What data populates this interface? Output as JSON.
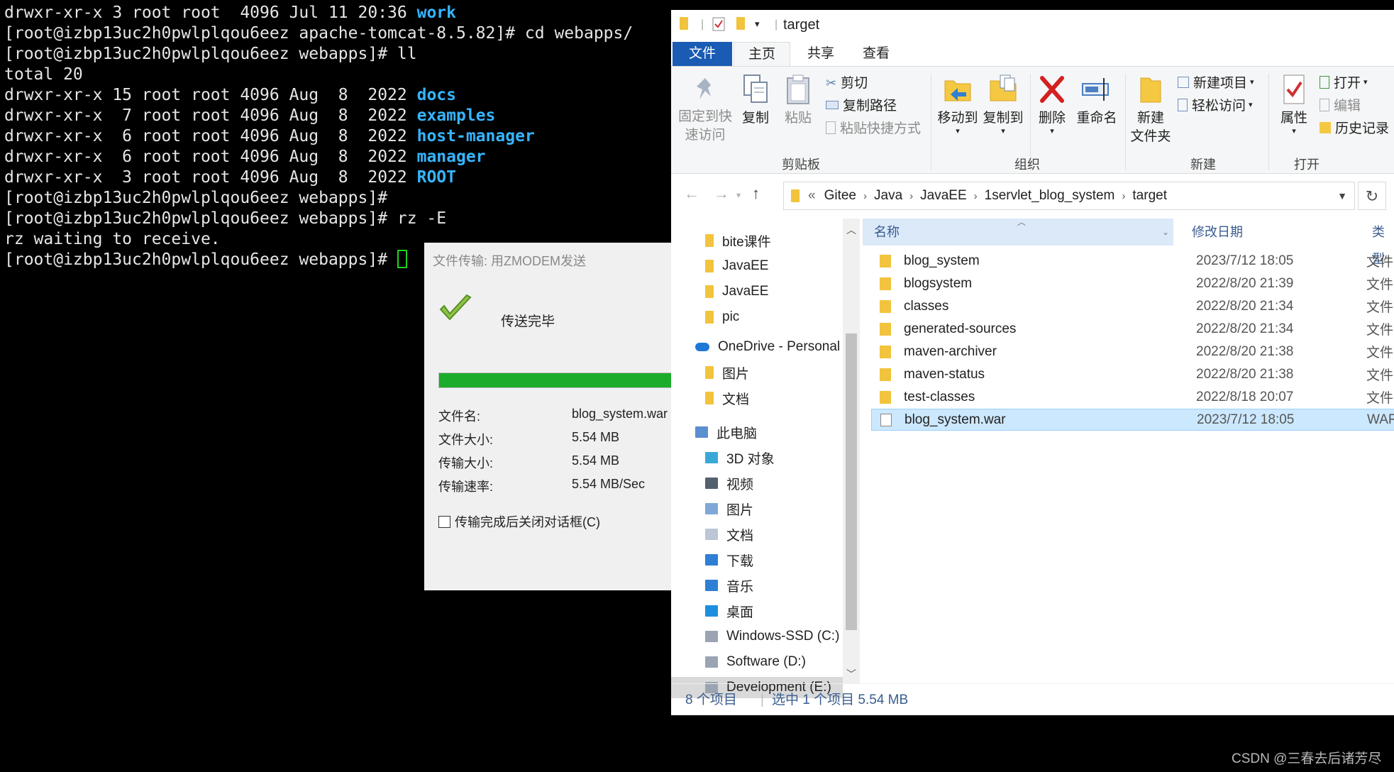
{
  "terminal": {
    "lines": [
      {
        "prefix": "drwxr-xr-x 3 root root  4096 Jul 11 20:36 ",
        "dir": "work"
      },
      {
        "prefix": "[root@izbp13uc2h0pwlplqou6eez apache-tomcat-8.5.82]# cd webapps/",
        "dir": ""
      },
      {
        "prefix": "[root@izbp13uc2h0pwlplqou6eez webapps]# ll",
        "dir": ""
      },
      {
        "prefix": "total 20",
        "dir": ""
      },
      {
        "prefix": "drwxr-xr-x 15 root root 4096 Aug  8  2022 ",
        "dir": "docs"
      },
      {
        "prefix": "drwxr-xr-x  7 root root 4096 Aug  8  2022 ",
        "dir": "examples"
      },
      {
        "prefix": "drwxr-xr-x  6 root root 4096 Aug  8  2022 ",
        "dir": "host-manager"
      },
      {
        "prefix": "drwxr-xr-x  6 root root 4096 Aug  8  2022 ",
        "dir": "manager"
      },
      {
        "prefix": "drwxr-xr-x  3 root root 4096 Aug  8  2022 ",
        "dir": "ROOT"
      },
      {
        "prefix": "[root@izbp13uc2h0pwlplqou6eez webapps]#",
        "dir": ""
      },
      {
        "prefix": "[root@izbp13uc2h0pwlplqou6eez webapps]# rz -E",
        "dir": ""
      },
      {
        "prefix": "rz waiting to receive.",
        "dir": ""
      },
      {
        "prefix": "[root@izbp13uc2h0pwlplqou6eez webapps]# ",
        "dir": ""
      }
    ],
    "colors": {
      "text": "#e6e6e6",
      "dir": "#35b5ff",
      "cursor": "#1fd21f"
    }
  },
  "zmodem": {
    "title": "文件传输: 用ZMODEM发送",
    "status": "传送完毕",
    "progress": 1.0,
    "rows": [
      {
        "label": "文件名:",
        "value": "blog_system.war"
      },
      {
        "label": "文件大小:",
        "value": "5.54 MB"
      },
      {
        "label": "传输大小:",
        "value": "5.54 MB"
      },
      {
        "label": "传输速率:",
        "value": "5.54 MB/Sec"
      }
    ],
    "close_checkbox_label": "传输完成后关闭对话框(C)",
    "close_checkbox_checked": false
  },
  "explorer": {
    "title": "target",
    "tabs": {
      "file": "文件",
      "home": "主页",
      "share": "共享",
      "view": "查看"
    },
    "ribbon": {
      "pin_label_1": "固定到快",
      "pin_label_2": "速访问",
      "copy": "复制",
      "paste": "粘贴",
      "cut": "剪切",
      "copy_path": "复制路径",
      "paste_shortcut": "粘贴快捷方式",
      "group_clipboard": "剪贴板",
      "move_to": "移动到",
      "copy_to": "复制到",
      "delete": "删除",
      "rename": "重命名",
      "group_organize": "组织",
      "new_folder_1": "新建",
      "new_folder_2": "文件夹",
      "new_item": "新建项目",
      "easy_access": "轻松访问",
      "group_new": "新建",
      "properties": "属性",
      "open": "打开",
      "edit": "编辑",
      "history": "历史记录",
      "group_open": "打开"
    },
    "breadcrumb": {
      "overflow": "«",
      "items": [
        "Gitee",
        "Java",
        "JavaEE",
        "1servlet_blog_system",
        "target"
      ]
    },
    "nav_items": [
      {
        "label": "bite课件",
        "icon": "folder-icon"
      },
      {
        "label": "JavaEE",
        "icon": "folder-icon"
      },
      {
        "label": "JavaEE",
        "icon": "folder-icon"
      },
      {
        "label": "pic",
        "icon": "folder-icon"
      },
      {
        "label": "OneDrive - Personal",
        "icon": "onedrive-icon"
      },
      {
        "label": "图片",
        "icon": "folder-icon"
      },
      {
        "label": "文档",
        "icon": "folder-icon"
      },
      {
        "label": "此电脑",
        "icon": "computer-icon"
      },
      {
        "label": "3D 对象",
        "icon": "cube-icon"
      },
      {
        "label": "视频",
        "icon": "video-icon"
      },
      {
        "label": "图片",
        "icon": "pictures-icon"
      },
      {
        "label": "文档",
        "icon": "documents-icon"
      },
      {
        "label": "下载",
        "icon": "download-icon"
      },
      {
        "label": "音乐",
        "icon": "music-icon"
      },
      {
        "label": "桌面",
        "icon": "desktop-icon"
      },
      {
        "label": "Windows-SSD (C:)",
        "icon": "drive-icon"
      },
      {
        "label": "Software (D:)",
        "icon": "drive-icon"
      },
      {
        "label": "Development (E:)",
        "icon": "drive-icon"
      }
    ],
    "columns": {
      "name": "名称",
      "date": "修改日期",
      "type": "类型"
    },
    "files": [
      {
        "name": "blog_system",
        "date": "2023/7/12 18:05",
        "type": "文件",
        "kind": "folder"
      },
      {
        "name": "blogsystem",
        "date": "2022/8/20 21:39",
        "type": "文件",
        "kind": "folder"
      },
      {
        "name": "classes",
        "date": "2022/8/20 21:34",
        "type": "文件",
        "kind": "folder"
      },
      {
        "name": "generated-sources",
        "date": "2022/8/20 21:34",
        "type": "文件",
        "kind": "folder"
      },
      {
        "name": "maven-archiver",
        "date": "2022/8/20 21:38",
        "type": "文件",
        "kind": "folder"
      },
      {
        "name": "maven-status",
        "date": "2022/8/20 21:38",
        "type": "文件",
        "kind": "folder"
      },
      {
        "name": "test-classes",
        "date": "2022/8/18 20:07",
        "type": "文件",
        "kind": "folder"
      },
      {
        "name": "blog_system.war",
        "date": "2023/7/12 18:05",
        "type": "WAR",
        "kind": "file"
      }
    ],
    "selected_index": 7,
    "status": {
      "count": "8 个项目",
      "selection": "选中 1 个项目  5.54 MB"
    }
  },
  "watermark": "CSDN @三春去后诸芳尽"
}
